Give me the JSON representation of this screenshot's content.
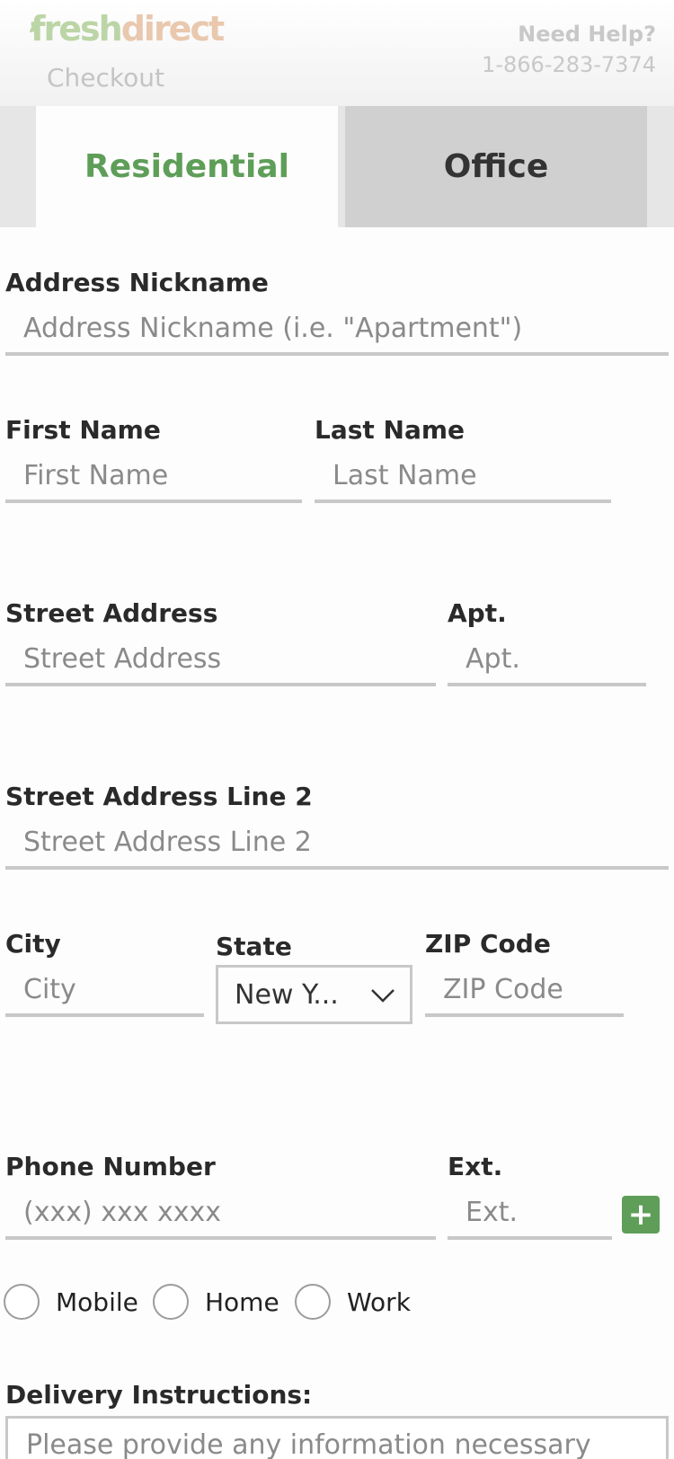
{
  "header": {
    "logo_fresh": "fresh",
    "logo_direct": "direct",
    "subtitle": "Checkout",
    "help_title": "Need Help?",
    "help_phone": "1-866-283-7374"
  },
  "tabs": [
    {
      "label": "Residential",
      "active": true
    },
    {
      "label": "Office",
      "active": false
    }
  ],
  "form": {
    "nickname": {
      "label": "Address Nickname",
      "placeholder": "Address Nickname (i.e. \"Apartment\")"
    },
    "first_name": {
      "label": "First Name",
      "placeholder": "First Name"
    },
    "last_name": {
      "label": "Last Name",
      "placeholder": "Last Name"
    },
    "street": {
      "label": "Street Address",
      "placeholder": "Street Address"
    },
    "apt": {
      "label": "Apt.",
      "placeholder": "Apt."
    },
    "street2": {
      "label": "Street Address Line 2",
      "placeholder": "Street Address Line 2"
    },
    "city": {
      "label": "City",
      "placeholder": "City"
    },
    "state": {
      "label": "State",
      "selected": "New Y..."
    },
    "zip": {
      "label": "ZIP Code",
      "placeholder": "ZIP Code"
    },
    "phone": {
      "label": "Phone Number",
      "placeholder": "(xxx) xxx xxxx"
    },
    "ext": {
      "label": "Ext.",
      "placeholder": "Ext.",
      "add_symbol": "+"
    },
    "phone_types": [
      "Mobile",
      "Home",
      "Work"
    ],
    "instructions": {
      "label": "Delivery Instructions:",
      "placeholder": "Please provide any information necessary"
    }
  },
  "colors": {
    "accent": "#5e9e58",
    "border": "#c8c8c8"
  }
}
